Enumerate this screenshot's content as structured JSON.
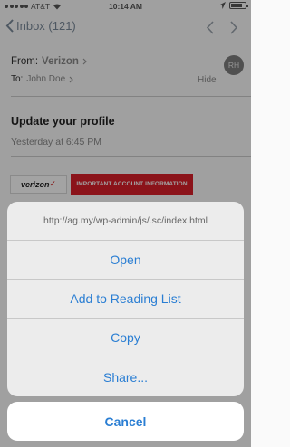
{
  "status": {
    "carrier": "AT&T",
    "time": "10:14 AM",
    "battery_level": 0.7
  },
  "nav": {
    "back_label": "Inbox (121)"
  },
  "email": {
    "from_label": "From:",
    "sender": "Verizon",
    "to_label": "To:",
    "recipient": "John Doe",
    "avatar_initials": "RH",
    "hide_label": "Hide",
    "subject": "Update your profile",
    "date": "Yesterday at 6:45 PM",
    "logo_text": "verizon",
    "banner_text": "IMPORTANT ACCOUNT INFORMATION"
  },
  "sheet": {
    "url": "http://ag.my/wp-admin/js/.sc/index.html",
    "actions": [
      "Open",
      "Add to Reading List",
      "Copy",
      "Share..."
    ],
    "cancel_label": "Cancel"
  },
  "colors": {
    "accent": "#2a7ed3",
    "banner": "#d91e2a"
  }
}
